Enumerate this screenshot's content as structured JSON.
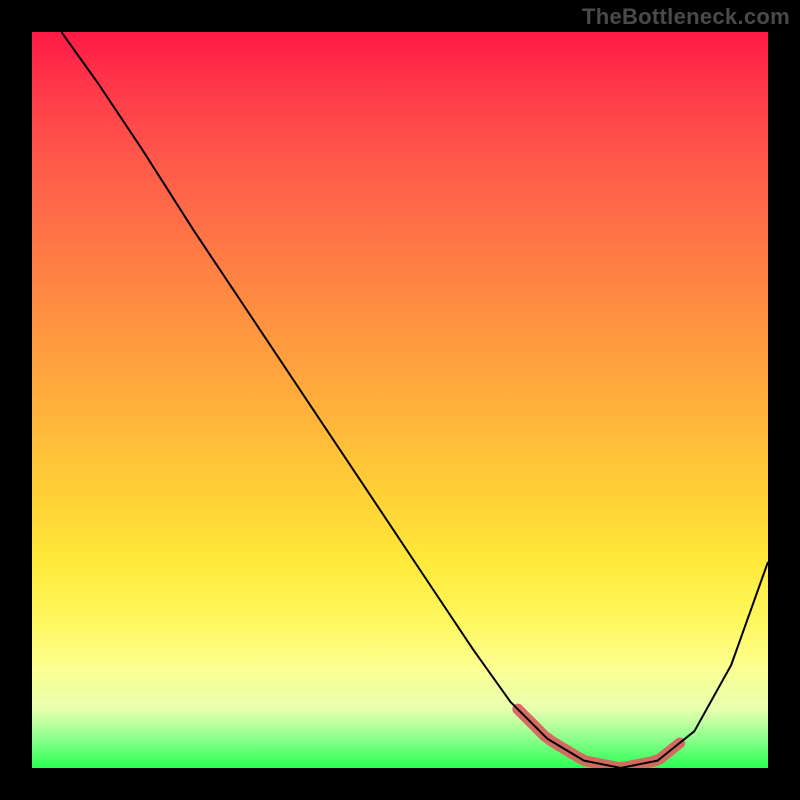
{
  "watermark": "TheBottleneck.com",
  "colors": {
    "frame_bg": "#000000",
    "band": "#d9635e",
    "curve": "#000000"
  },
  "chart_data": {
    "type": "line",
    "title": "",
    "xlabel": "",
    "ylabel": "",
    "xlim": [
      0,
      100
    ],
    "ylim": [
      0,
      100
    ],
    "grid": false,
    "series": [
      {
        "name": "curve",
        "x": [
          4,
          9,
          15,
          22,
          30,
          38,
          46,
          54,
          60,
          65,
          70,
          75,
          80,
          85,
          90,
          95,
          100
        ],
        "values": [
          100,
          93,
          84,
          73,
          61,
          49,
          37,
          25,
          16,
          9,
          4,
          1,
          0,
          1,
          5,
          14,
          28
        ]
      }
    ],
    "highlight_band": {
      "x_start": 66,
      "x_end": 88
    }
  }
}
